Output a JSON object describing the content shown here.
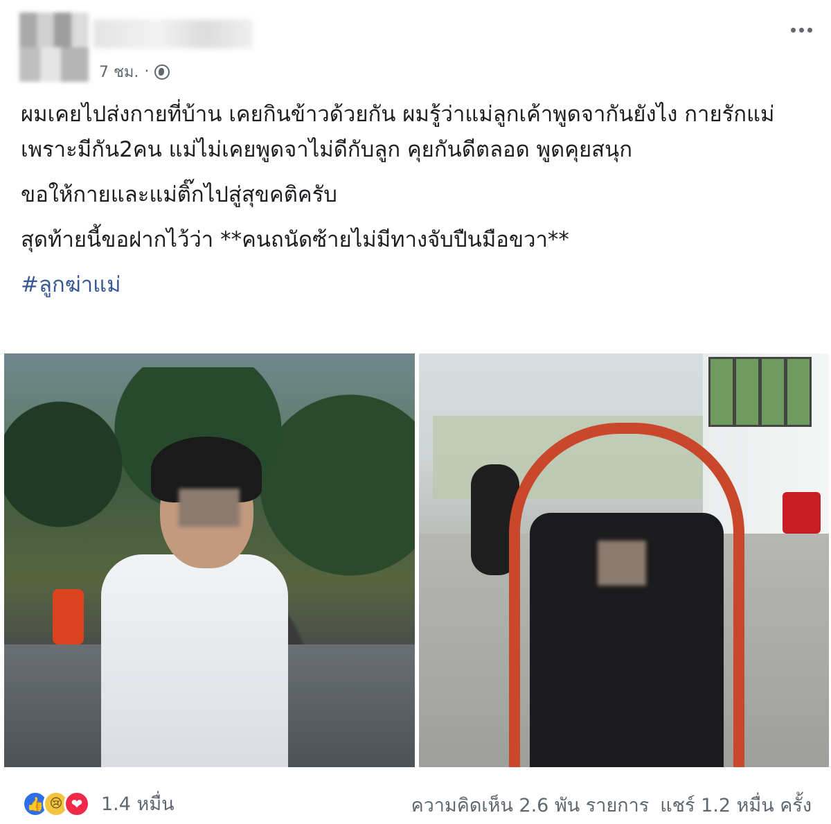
{
  "header": {
    "time": "7 ชม.",
    "separator": "·"
  },
  "post": {
    "paragraphs": [
      "ผมเคยไปส่งกายที่บ้าน เคยกินข้าวด้วยกัน ผมรู้ว่าแม่ลูกเค้าพูดจากันยังไง กายรักแม่เพราะมีกัน2คน แม่ไม่เคยพูดจาไม่ดีกับลูก คุยกันดีตลอด พูดคุยสนุก",
      "ขอให้กายและแม่ติ๊กไปสู่สุขคติครับ",
      "สุดท้ายนี้ขอฝากไว้ว่า **คนถนัดซ้ายไม่มีทางจับปืนมือขวา**"
    ],
    "hashtag": "#ลูกฆ่าแม่"
  },
  "footer": {
    "reaction_icons": [
      "like-icon",
      "sad-icon",
      "love-icon"
    ],
    "reaction_count": "1.4 หมื่น",
    "comments": "ความคิดเห็น 2.6 พัน รายการ",
    "shares": "แชร์ 1.2 หมื่น ครั้ง"
  },
  "colors": {
    "text": "#1c1e21",
    "meta": "#606770",
    "hashtag": "#385898",
    "like": "#2d6fe6",
    "love": "#f0284a"
  }
}
